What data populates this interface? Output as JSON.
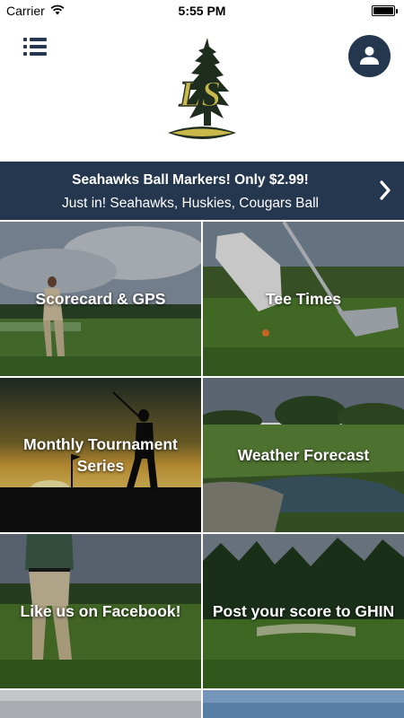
{
  "status_bar": {
    "carrier": "Carrier",
    "time": "5:55 PM",
    "icons": [
      "wifi-icon",
      "battery-icon"
    ]
  },
  "header": {
    "logo_text": "LS",
    "menu_icon": "list-menu-icon",
    "profile_icon": "user-icon"
  },
  "colors": {
    "navy": "#25364f",
    "logo_gold": "#c9b84a"
  },
  "promo": {
    "title": "Seahawks Ball Markers! Only $2.99!",
    "subtitle": "Just in! Seahawks, Huskies, Cougars Ball",
    "icon": "chevron-right-icon"
  },
  "tiles": [
    {
      "label": "Scorecard & GPS"
    },
    {
      "label": "Tee Times"
    },
    {
      "label": "Monthly Tournament Series"
    },
    {
      "label": "Weather Forecast"
    },
    {
      "label": "Like us on Facebook!"
    },
    {
      "label": "Post your score to GHIN"
    }
  ]
}
